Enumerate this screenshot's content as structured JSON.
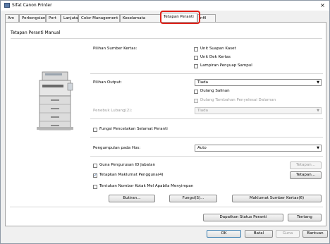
{
  "window": {
    "title": "Sifat Canon Printer",
    "close_glyph": "×"
  },
  "tabs": [
    {
      "label": "Am"
    },
    {
      "label": "Perkongsian"
    },
    {
      "label": "Port"
    },
    {
      "label": "Lanjutan"
    },
    {
      "label": "Color Management"
    },
    {
      "label": "Keselamata"
    },
    {
      "label": "Tetapan Peranti"
    },
    {
      "label": "nfil"
    }
  ],
  "active_tab": "Tetapan Peranti",
  "highlight_color": "#e0221a",
  "panel": {
    "header": "Tetapan Peranti Manual",
    "paper_source": {
      "label": "Pilihan Sumber Kertas:",
      "options": [
        {
          "label": "Unit Suapan Kaset",
          "checked": false
        },
        {
          "label": "Unit Dek Kertas",
          "checked": false
        },
        {
          "label": "Lampiran Penyuap Sampul",
          "checked": false
        }
      ]
    },
    "output": {
      "label": "Pilihan Output:",
      "value": "Tiada",
      "options": [
        {
          "label": "Dulang Salinan",
          "checked": false,
          "enabled": true
        },
        {
          "label": "Dulang Tambahan Penyelesai Dalaman",
          "checked": false,
          "enabled": false
        }
      ]
    },
    "paper_output": {
      "label": "Penebuk Lubang(2):",
      "value": "Tiada",
      "enabled": false
    },
    "secure_print": {
      "label": "Fungsi Pencetakan Selamat Peranti",
      "checked": false
    },
    "host_spooling": {
      "label": "Pengumpulan pada Hos:",
      "value": "Auto"
    },
    "dept_id": {
      "label": "Guna Pengurusan ID Jabatan",
      "checked": false,
      "button": "Tetapan..."
    },
    "user_info": {
      "label": "Tetapkan Maklumat Pengguna(4)",
      "checked": true,
      "button": "Tetapan..."
    },
    "mailbox": {
      "label": "Tentukan Nombor Kotak Mel Apabila Menyimpan",
      "checked": false
    },
    "buttons": {
      "details": "Butiran...",
      "functions": "Fungsi(S)...",
      "paper_info": "Maklumat Sumber Kertas(6)"
    },
    "get_status": "Dapatkan Status Peranti",
    "about": "Tentang"
  },
  "footer": {
    "ok": "OK",
    "cancel": "Batal",
    "apply": "Guna",
    "help": "Bantuan"
  },
  "icons": {
    "app": "printer-icon",
    "dropdown": "chevron-down-icon",
    "close": "close-icon"
  }
}
